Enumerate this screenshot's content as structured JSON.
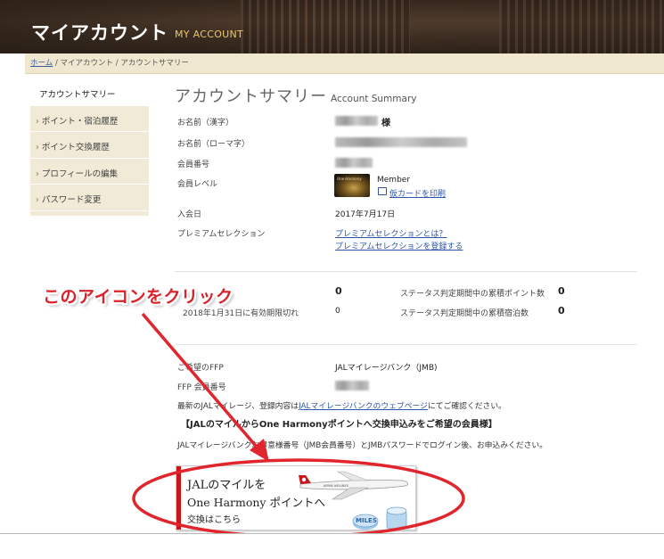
{
  "header": {
    "title": "マイアカウント",
    "subtitle": "MY ACCOUNT"
  },
  "breadcrumb": {
    "home": "ホーム",
    "sep1": " / ",
    "level1": "マイアカウント",
    "sep2": " / ",
    "current": "アカウントサマリー"
  },
  "sidebar": {
    "items": [
      {
        "label": "アカウントサマリー",
        "arrow": ""
      },
      {
        "label": "ポイント・宿泊履歴",
        "arrow": "›"
      },
      {
        "label": "ポイント交換履歴",
        "arrow": "›"
      },
      {
        "label": "プロフィールの編集",
        "arrow": "›"
      },
      {
        "label": "パスワード変更",
        "arrow": "›"
      }
    ]
  },
  "main": {
    "title": "アカウントサマリー",
    "title_en": "Account Summary",
    "rows": [
      {
        "label": "お名前（漢字）",
        "value": "様"
      },
      {
        "label": "お名前（ローマ字）",
        "value": ""
      },
      {
        "label": "会員番号",
        "value": ""
      },
      {
        "label": "会員レベル",
        "value": "Member"
      },
      {
        "label": "入会日",
        "value": "2017年7月17日"
      },
      {
        "label": "プレミアムセレクション",
        "value": ""
      }
    ],
    "card_text": "One Harmony",
    "print_card": "仮カードを印刷",
    "premium_links": [
      "プレミアムセレクションとは？",
      "プレミアムセレクションを登録する"
    ],
    "points": {
      "expiry_label": "2018年1月31日に有効期限切れ",
      "current": "0",
      "expiry_value": "0",
      "status_points_label": "ステータス判定期間中の累積ポイント数",
      "status_points_value": "0",
      "status_nights_label": "ステータス判定期間中の累積宿泊数",
      "status_nights_value": "0"
    },
    "ffp": {
      "label": "ご希望のFFP",
      "value": "JALマイレージバンク（JMB)",
      "number_label": "FFP 会員番号",
      "number_value": ""
    },
    "note1_pre": "最新のJALマイレージ、登録内容は",
    "note1_link": "JALマイレージバンクのウェブページ",
    "note1_post": "にてご確認ください。",
    "heading": "【JALのマイルからOne Harmonyポイントへ交換申込みをご希望の会員様】",
    "note2": "JALマイレージバンクお得意様番号（JMB会員番号）とJMBパスワードでログイン後、お申込みください。"
  },
  "banner": {
    "line1": "JALのマイルを",
    "line2": "One Harmony ポイントへ",
    "line3": "交換はこちら",
    "miles": "MILES",
    "airline_mark": "JAPAN AIRLINES"
  },
  "annotation": {
    "text": "このアイコンをクリック",
    "color": "#d9222a"
  }
}
